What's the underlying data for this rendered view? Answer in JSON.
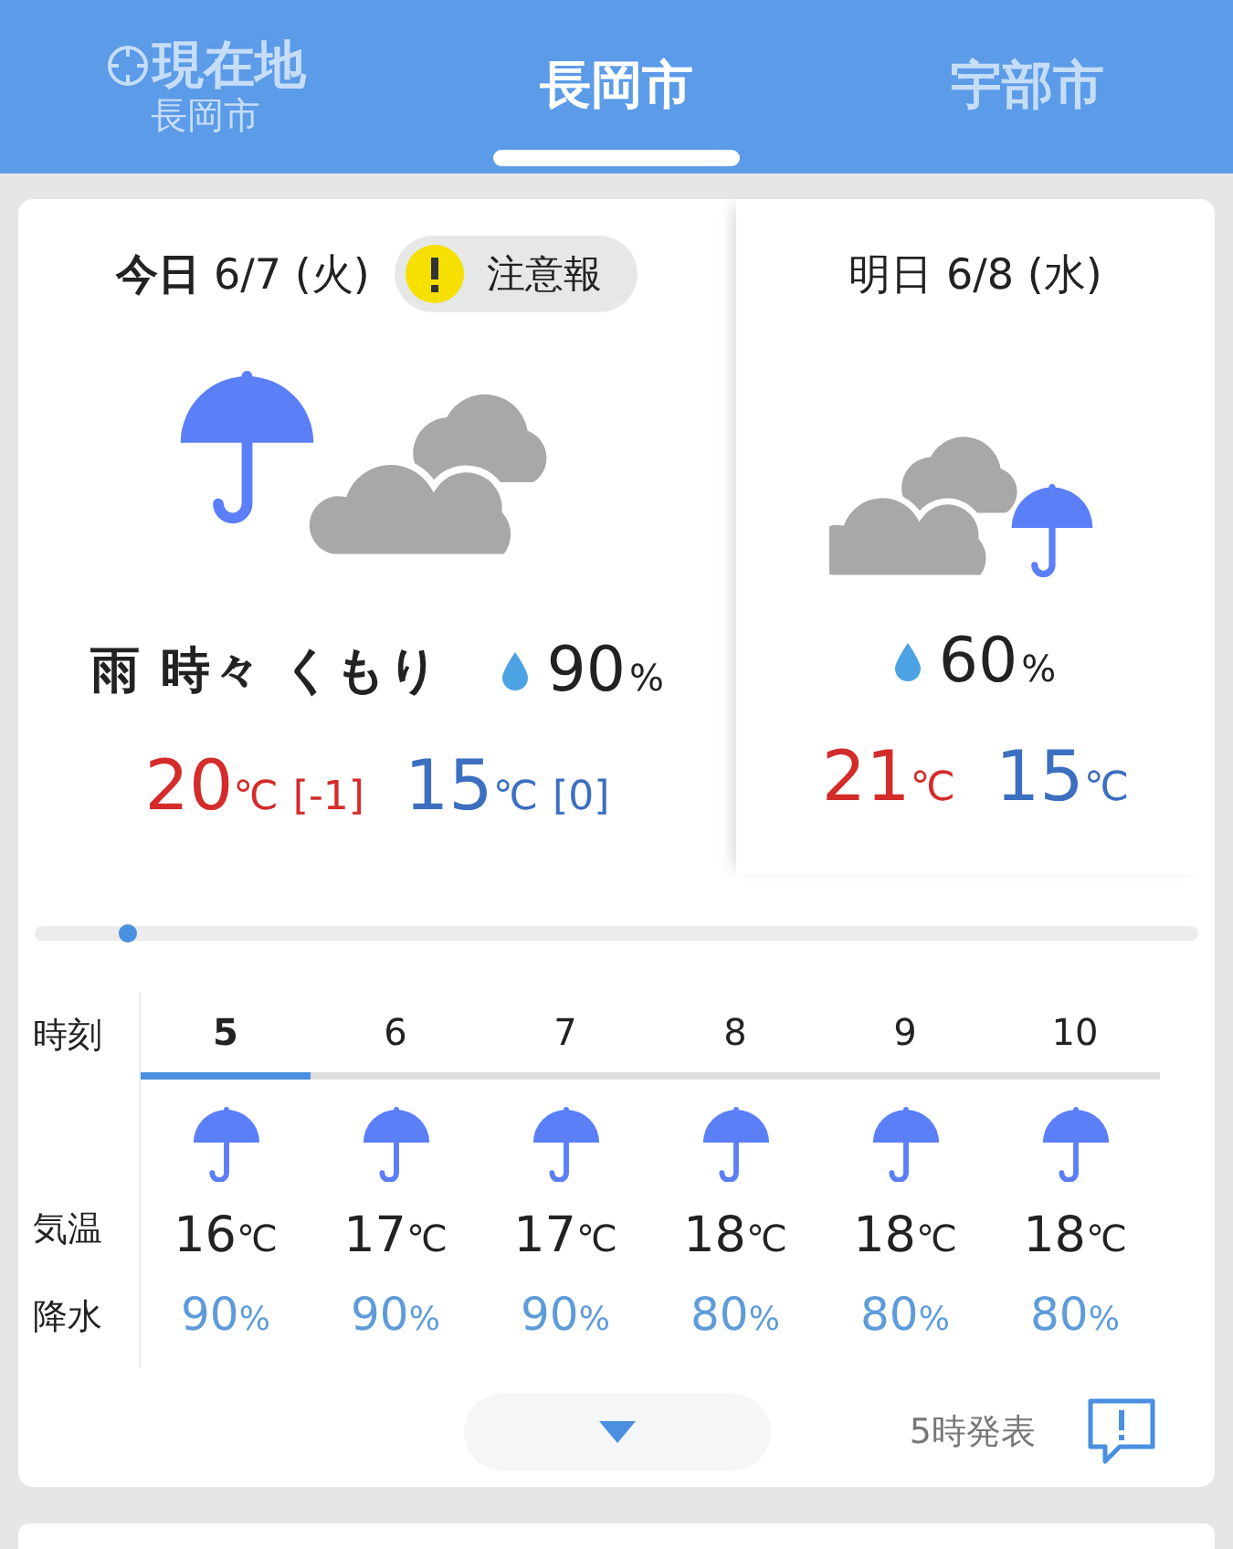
{
  "tabs": [
    {
      "kind": "location",
      "label": "現在地",
      "sublabel": "長岡市",
      "selected": false
    },
    {
      "kind": "city",
      "label": "長岡市",
      "selected": true
    },
    {
      "kind": "city",
      "label": "宇部市",
      "selected": false
    }
  ],
  "today": {
    "day": "今日",
    "date": "6/7 (火)",
    "warning": "注意報",
    "weather": "雨 時々 くもり",
    "precip": "90",
    "precip_unit": "%",
    "high": {
      "value": "20",
      "unit": "℃",
      "diff": "[-1]"
    },
    "low": {
      "value": "15",
      "unit": "℃",
      "diff": "[0]"
    }
  },
  "tomorrow": {
    "day": "明日",
    "date": "6/8 (水)",
    "precip": "60",
    "precip_unit": "%",
    "high": {
      "value": "21",
      "unit": "℃"
    },
    "low": {
      "value": "15",
      "unit": "℃"
    }
  },
  "timeline": {
    "level": 0.08
  },
  "hourly": {
    "labels": [
      "時刻",
      "気温",
      "降水"
    ],
    "hours": [
      {
        "hour": "5",
        "temp": "16",
        "temp_unit": "℃",
        "precip": "90",
        "precip_unit": "%",
        "selected": true
      },
      {
        "hour": "6",
        "temp": "17",
        "temp_unit": "℃",
        "precip": "90",
        "precip_unit": "%",
        "selected": false
      },
      {
        "hour": "7",
        "temp": "17",
        "temp_unit": "℃",
        "precip": "90",
        "precip_unit": "%",
        "selected": false
      },
      {
        "hour": "8",
        "temp": "18",
        "temp_unit": "℃",
        "precip": "80",
        "precip_unit": "%",
        "selected": false
      },
      {
        "hour": "9",
        "temp": "18",
        "temp_unit": "℃",
        "precip": "80",
        "precip_unit": "%",
        "selected": false
      },
      {
        "hour": "10",
        "temp": "18",
        "temp_unit": "℃",
        "precip": "80",
        "precip_unit": "%",
        "selected": false
      }
    ]
  },
  "issued": "5時発表"
}
